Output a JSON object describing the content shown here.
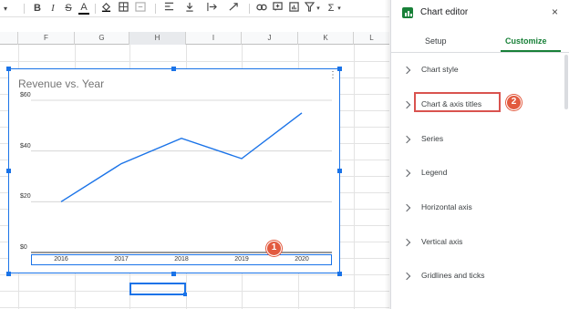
{
  "toolbar": {
    "bold_label": "B",
    "italic_label": "I",
    "strike_label": "S",
    "textcolor_label": "A",
    "sigma_label": "Σ"
  },
  "columns": [
    "F",
    "G",
    "H",
    "I",
    "J",
    "K",
    "L"
  ],
  "selected_column": "H",
  "chart": {
    "title": "Revenue vs. Year",
    "menu_label": "⋮"
  },
  "chart_data": {
    "type": "line",
    "title": "Revenue vs. Year",
    "categories": [
      "2016",
      "2017",
      "2018",
      "2019",
      "2020"
    ],
    "series": [
      {
        "values": [
          20,
          35,
          45,
          37,
          55
        ]
      }
    ],
    "y_ticks": [
      "$0",
      "$20",
      "$40",
      "$60"
    ],
    "ylim": [
      0,
      60
    ],
    "xlabel": "",
    "ylabel": "",
    "grid": true,
    "line_color": "#1a73e8"
  },
  "editor": {
    "title": "Chart editor",
    "close_label": "×",
    "tabs": [
      {
        "label": "Setup",
        "active": false
      },
      {
        "label": "Customize",
        "active": true
      }
    ],
    "sections": [
      {
        "label": "Chart style"
      },
      {
        "label": "Chart & axis titles"
      },
      {
        "label": "Series"
      },
      {
        "label": "Legend"
      },
      {
        "label": "Horizontal axis"
      },
      {
        "label": "Vertical axis"
      },
      {
        "label": "Gridlines and ticks"
      }
    ]
  },
  "annotations": [
    {
      "number": "1"
    },
    {
      "number": "2"
    }
  ],
  "colors": {
    "accent_blue": "#1a73e8",
    "accent_green": "#188038",
    "annotation_red": "#e25a3f"
  }
}
